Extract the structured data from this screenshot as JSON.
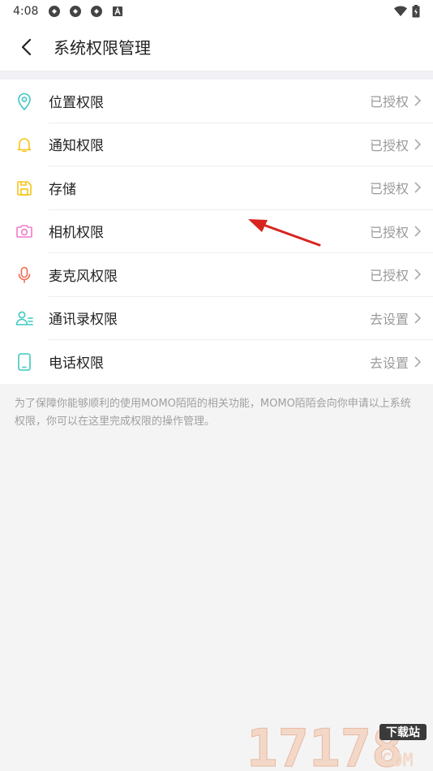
{
  "status_bar": {
    "time": "4:08"
  },
  "header": {
    "title": "系统权限管理"
  },
  "permissions": [
    {
      "label": "位置权限",
      "status": "已授权",
      "icon": "location-icon",
      "color": "#3fc7c0"
    },
    {
      "label": "通知权限",
      "status": "已授权",
      "icon": "bell-icon",
      "color": "#f5c518"
    },
    {
      "label": "存储",
      "status": "已授权",
      "icon": "storage-icon",
      "color": "#f5c518"
    },
    {
      "label": "相机权限",
      "status": "已授权",
      "icon": "camera-icon",
      "color": "#f07acb"
    },
    {
      "label": "麦克风权限",
      "status": "已授权",
      "icon": "microphone-icon",
      "color": "#f26b4f"
    },
    {
      "label": "通讯录权限",
      "status": "去设置",
      "icon": "contacts-icon",
      "color": "#3fc7c0"
    },
    {
      "label": "电话权限",
      "status": "去设置",
      "icon": "phone-icon",
      "color": "#3fc7c0"
    }
  ],
  "note": "为了保障你能够顺利的使用MOMO陌陌的相关功能，MOMO陌陌会向你申请以上系统权限，你可以在这里完成权限的操作管理。",
  "watermark": {
    "number": "17178",
    "tag": "下载站",
    "domain": "COM"
  }
}
